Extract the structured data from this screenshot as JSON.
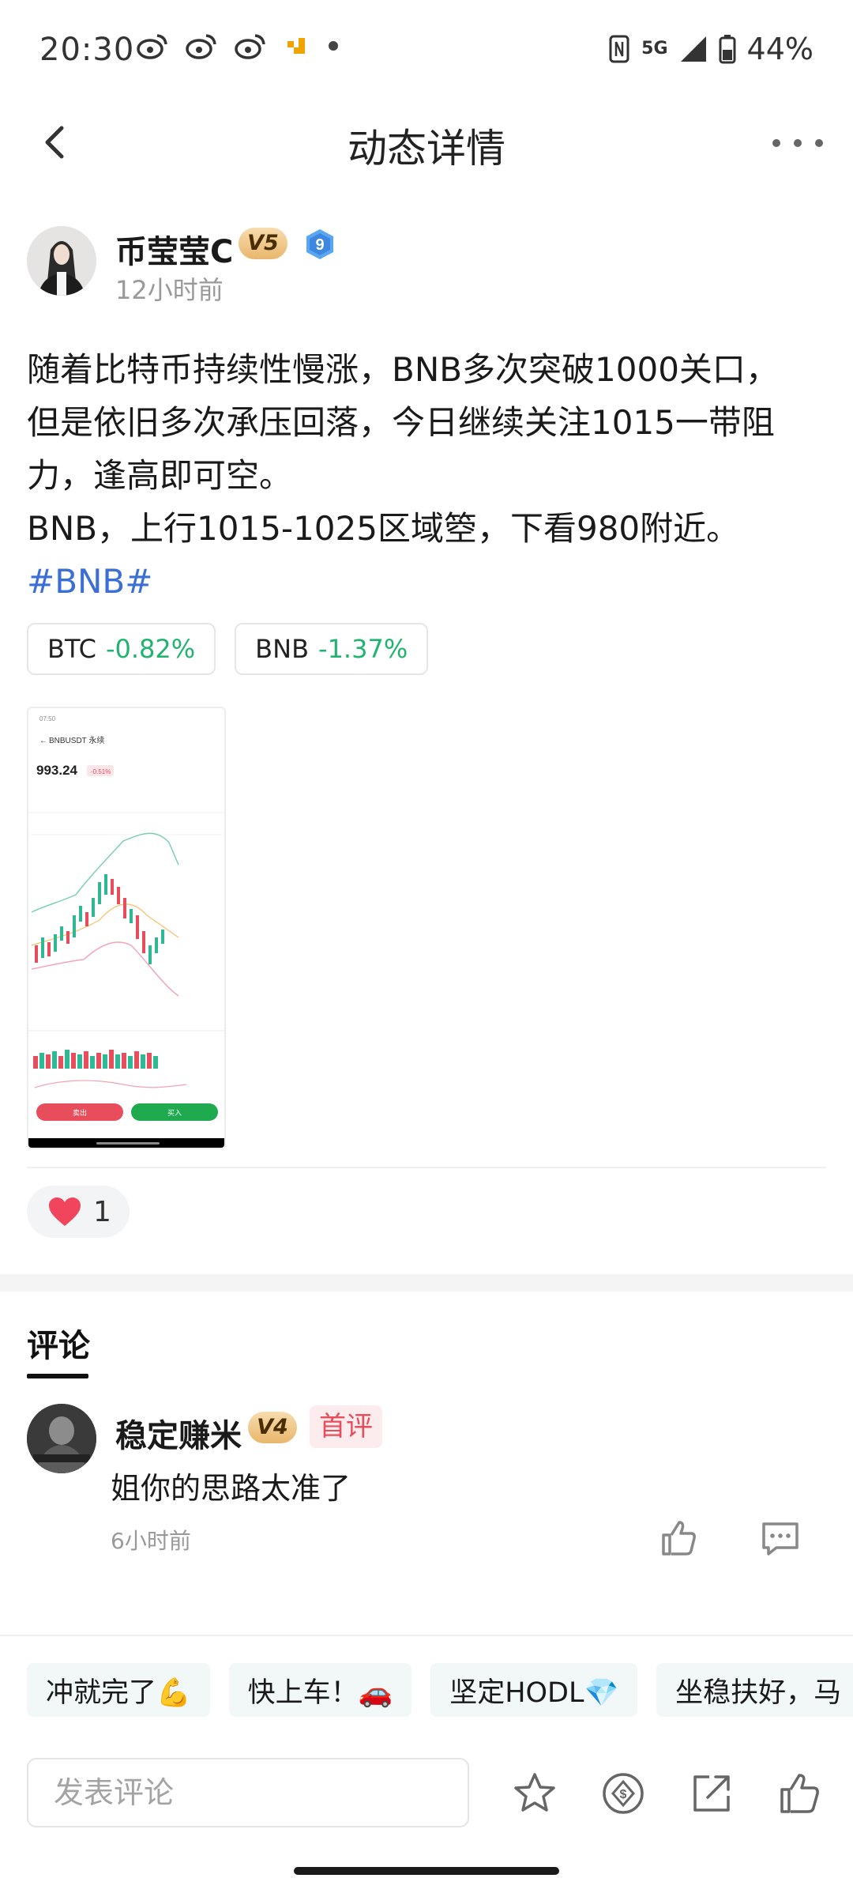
{
  "status_bar": {
    "time": "20:30",
    "network": "5G",
    "battery": "44%"
  },
  "nav": {
    "title": "动态详情"
  },
  "author": {
    "name": "币莹莹C",
    "level": "V5",
    "rank": "9",
    "time": "12小时前"
  },
  "post": {
    "lines": [
      "随着比特币持续性慢涨，BNB多次突破1000关口，",
      "但是依旧多次承压回落，今日继续关注1015一带阻",
      "力，逢高即可空。",
      "BNB，上行1015-1025区域箜，下看980附近。"
    ],
    "hashtag": "#BNB#"
  },
  "coins": [
    {
      "symbol": "BTC",
      "change": "-0.82%"
    },
    {
      "symbol": "BNB",
      "change": "-1.37%"
    }
  ],
  "thumbnail": {
    "pair": "BNBUSDT 永续",
    "price": "993.24",
    "change": "-0.51%",
    "sell": "卖出",
    "buy": "买入"
  },
  "likes": {
    "count": "1"
  },
  "comments": {
    "tab_label": "评论",
    "items": [
      {
        "name": "稳定赚米",
        "level": "V4",
        "badge": "首评",
        "text": "姐你的思路太准了",
        "time": "6小时前"
      }
    ]
  },
  "quick_replies": [
    "冲就完了💪",
    "快上车！🚗",
    "坚定HODL💎",
    "坐稳扶好，马"
  ],
  "input": {
    "placeholder": "发表评论"
  },
  "colors": {
    "positive_green": "#21b36f",
    "hashtag_blue": "#3b6fd6",
    "level_badge": "#e8b76c",
    "first_comment_red": "#e84d5b"
  }
}
